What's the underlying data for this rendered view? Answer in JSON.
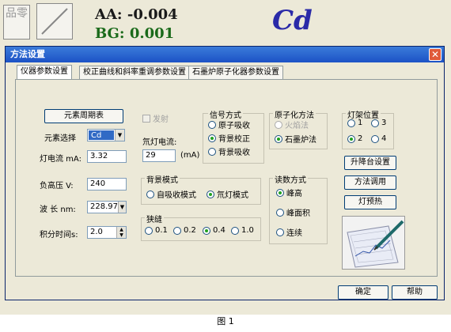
{
  "background": {
    "tool_text": "品零",
    "readout_aa": "AA: -0.004",
    "readout_bg": "BG:  0.001",
    "element_symbol": "Cd"
  },
  "dialog": {
    "title": "方法设置",
    "close_glyph": "✕",
    "tabs": [
      "仪器参数设置",
      "校正曲线和斜率重调参数设置",
      "石墨炉原子化器参数设置"
    ],
    "periodic_table_button": "元素周期表",
    "emission_checkbox": "发射",
    "element_label": "元素选择",
    "element_value": "Cd",
    "lamp_current_label": "灯电流 mA:",
    "lamp_current_value": "3.32",
    "negative_hv_label": "负高压 V:",
    "negative_hv_value": "240",
    "wavelength_label": "波 长 nm:",
    "wavelength_value": "228.97",
    "integration_time_label": "积分时间s:",
    "integration_time_value": "2.0",
    "deuterium_current_label": "氘灯电流:",
    "deuterium_current_value": "29",
    "deuterium_unit": "(mA)",
    "signal_mode": {
      "legend": "信号方式",
      "options": [
        "原子吸收",
        "背景校正",
        "背景吸收"
      ],
      "selected": "背景校正"
    },
    "atomization": {
      "legend": "原子化方法",
      "options": [
        "火焰法",
        "石墨炉法"
      ],
      "selected": "石墨炉法"
    },
    "lamp_position": {
      "legend": "灯架位置",
      "options": [
        "1",
        "3",
        "2",
        "4"
      ],
      "selected": "2"
    },
    "background_mode": {
      "legend": "背景模式",
      "options": [
        "自吸收模式",
        "氘灯模式"
      ],
      "selected": "氘灯模式"
    },
    "slit": {
      "legend": "狭缝",
      "options": [
        "0.1",
        "0.2",
        "0.4",
        "1.0"
      ],
      "selected": "0.4"
    },
    "read_mode": {
      "legend": "读数方式",
      "options": [
        "峰高",
        "峰面积",
        "连续"
      ],
      "selected": "峰高"
    },
    "buttons": {
      "lift": "升降台设置",
      "method_load": "方法调用",
      "lamp_preheat": "灯预热",
      "ok": "确定",
      "help": "帮助"
    }
  },
  "caption": "图 1",
  "colors": {
    "titlebar": "#245edb",
    "readout": "#1a1a1a",
    "cd_symbol": "#2a2aa8",
    "radio_selected": "#21a121"
  }
}
